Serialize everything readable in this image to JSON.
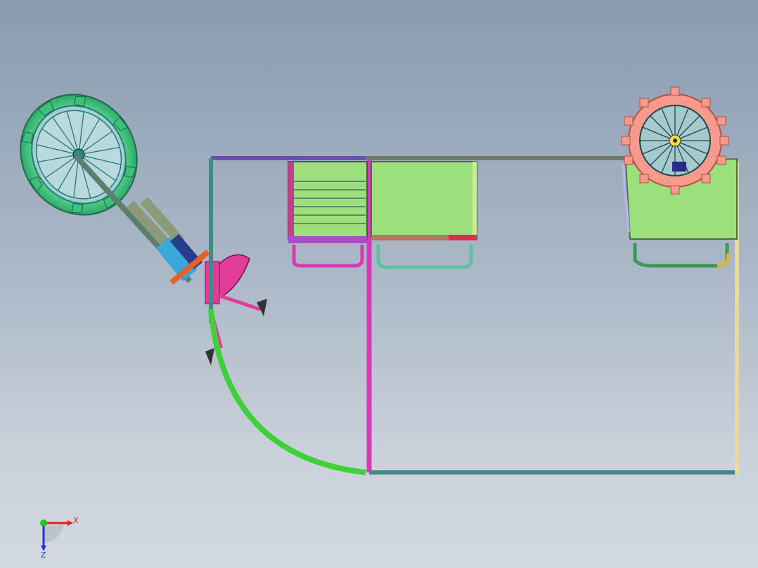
{
  "view": {
    "background_top": "#8a9bb1",
    "background_bottom": "#d3d9e0"
  },
  "triad": {
    "x_label": "X",
    "z_label": "Z",
    "x_color": "#e0221a",
    "y_color": "#22c033",
    "z_color": "#2233d0"
  },
  "palette": {
    "frame_teal": "#3f8a86",
    "frame_magenta": "#d63ab5",
    "frame_purple": "#6a4fb8",
    "frame_cream": "#e8d8a8",
    "tire_green": "#5fe49a",
    "tire_pink": "#f59a8c",
    "seat_green": "#9be07a",
    "curve_green": "#3ed13a",
    "fork_blue": "#3aa7d9",
    "hub_pink": "#e23c9b",
    "ring_orange": "#e6612a"
  }
}
